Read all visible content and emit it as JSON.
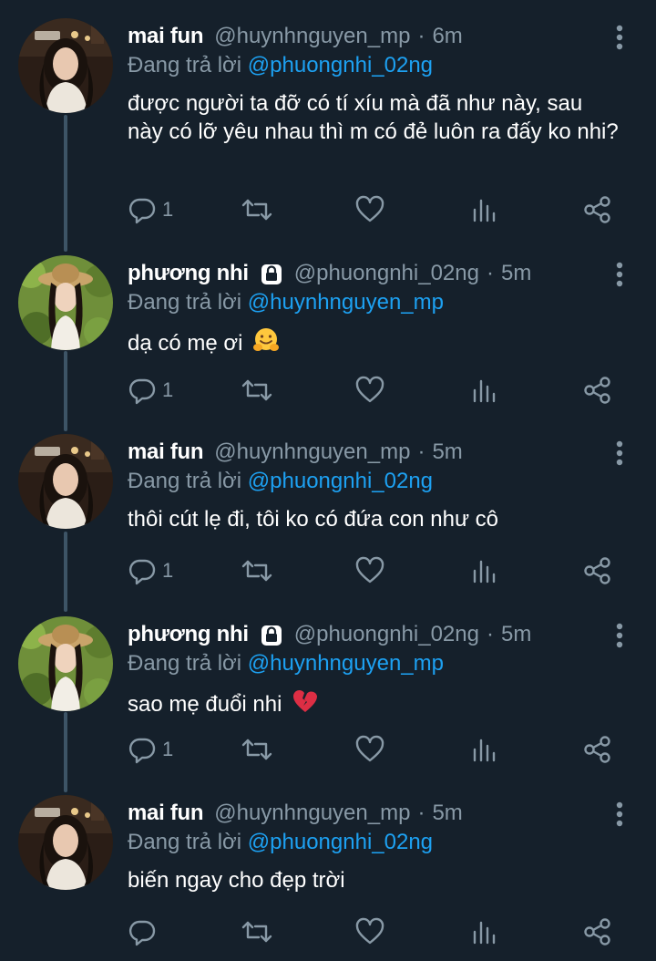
{
  "tweets": [
    {
      "name": "mai fun",
      "handle": "@huynhnguyen_mp",
      "separator": "·",
      "time": "6m",
      "locked": false,
      "reply_prefix": "Đang trả lời",
      "reply_to": "@phuongnhi_02ng",
      "text": "được người ta đỡ có tí xíu mà đã như này, sau này có lỡ yêu nhau thì m có đẻ luôn ra đấy ko nhi?",
      "reply_count": "1",
      "emoji": ""
    },
    {
      "name": "phương nhi",
      "handle": "@phuongnhi_02ng",
      "separator": "·",
      "time": "5m",
      "locked": true,
      "reply_prefix": "Đang trả lời",
      "reply_to": "@huynhnguyen_mp",
      "text": "dạ có mẹ ơi",
      "reply_count": "1",
      "emoji": "hugging-face"
    },
    {
      "name": "mai fun",
      "handle": "@huynhnguyen_mp",
      "separator": "·",
      "time": "5m",
      "locked": false,
      "reply_prefix": "Đang trả lời",
      "reply_to": "@phuongnhi_02ng",
      "text": "thôi cút lẹ đi, tôi ko có đứa con như cô",
      "reply_count": "1",
      "emoji": ""
    },
    {
      "name": "phương nhi",
      "handle": "@phuongnhi_02ng",
      "separator": "·",
      "time": "5m",
      "locked": true,
      "reply_prefix": "Đang trả lời",
      "reply_to": "@huynhnguyen_mp",
      "text": "sao mẹ đuổi nhi",
      "reply_count": "1",
      "emoji": "broken-heart"
    },
    {
      "name": "mai fun",
      "handle": "@huynhnguyen_mp",
      "separator": "·",
      "time": "5m",
      "locked": false,
      "reply_prefix": "Đang trả lời",
      "reply_to": "@phuongnhi_02ng",
      "text": "biến ngay cho đẹp trời",
      "reply_count": "",
      "emoji": ""
    }
  ],
  "icons": {
    "reply": "reply-icon",
    "retweet": "retweet-icon",
    "like": "like-icon",
    "analytics": "analytics-icon",
    "share": "share-icon",
    "more": "more-vertical-icon",
    "lock": "lock-icon"
  },
  "colors": {
    "background": "#15202b",
    "secondary_text": "#8899a6",
    "link": "#1da1f2",
    "thread_line": "#3d5466"
  }
}
